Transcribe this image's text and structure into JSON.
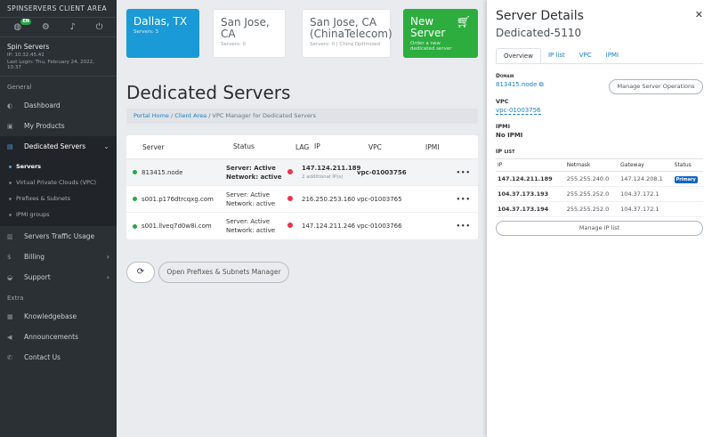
{
  "sidebar": {
    "brand": "SPINSERVERS CLIENT AREA",
    "lang": "EN",
    "user": {
      "name": "Spin Servers",
      "ip": "IP: 10.32.45.42",
      "login": "Last Login: Thu, February 24, 2022, 10:37"
    },
    "section_general": "General",
    "dashboard": "Dashboard",
    "products": "My Products",
    "dedicated": "Dedicated Servers",
    "sub": [
      "Servers",
      "Virtual Private Clouds (VPC)",
      "Prefixes & Subnets",
      "IPMI groups"
    ],
    "traffic": "Servers Traffic Usage",
    "billing": "Billing",
    "support": "Support",
    "section_extra": "Extra",
    "kb": "Knowledgebase",
    "ann": "Announcements",
    "contact": "Contact Us"
  },
  "cards": {
    "dallas": {
      "title": "Dallas, TX",
      "sub": "Servers: 3"
    },
    "sanjose": {
      "title": "San Jose, CA",
      "sub": "Servers: 0"
    },
    "sanjose_ct": {
      "title": "San Jose, CA (ChinaTelecom)",
      "sub": "Servers: 0 | China Optimized"
    },
    "new": {
      "title": "New Server",
      "sub": "Order a new dedicated server"
    }
  },
  "page": {
    "title": "Dedicated Servers",
    "crumbs": [
      "Portal Home",
      "Client Area",
      "VPC Manager for Dedicated Servers"
    ],
    "crumb_sep": "/",
    "table": {
      "headers": [
        "Server",
        "Status",
        "LAG",
        "IP",
        "VPC",
        "IPMI"
      ],
      "rows": [
        {
          "server": "813415.node",
          "status1": "Server: Active",
          "status2": "Network: active",
          "ip": "147.124.211.189",
          "extra": "2 additional IP(s)",
          "vpc": "vpc-01003756"
        },
        {
          "server": "s001.p176dtrcqxg.com",
          "status1": "Server: Active",
          "status2": "Network: active",
          "ip": "216.250.253.160",
          "extra": "",
          "vpc": "vpc-01003765"
        },
        {
          "server": "s001.llveq7d0w8i.com",
          "status1": "Server: Active",
          "status2": "Network: active",
          "ip": "147.124.211.246",
          "extra": "",
          "vpc": "vpc-01003766"
        }
      ],
      "dots": "•••"
    },
    "open_button": "Open Prefixes & Subnets Manager"
  },
  "panel": {
    "title": "Server Details",
    "subtitle": "Dedicated-5110",
    "close": "✕",
    "tabs": [
      "Overview",
      "IP list",
      "VPC",
      "IPMI"
    ],
    "domain_label": "Domain",
    "domain": "813415.node",
    "manage_ops": "Manage Server Operations",
    "vpc_label": "VPC",
    "vpc": "vpc-01003756",
    "ipmi_label": "IPMI",
    "ipmi": "No IPMI",
    "iplist_label": "IP list",
    "ip_headers": [
      "IP",
      "Netmask",
      "Gateway",
      "Status"
    ],
    "ips": [
      {
        "ip": "147.124.211.189",
        "mask": "255.255.240.0",
        "gw": "147.124.208.1",
        "status": "Primary"
      },
      {
        "ip": "104.37.173.193",
        "mask": "255.255.252.0",
        "gw": "104.37.172.1",
        "status": ""
      },
      {
        "ip": "104.37.173.194",
        "mask": "255.255.252.0",
        "gw": "104.37.172.1",
        "status": ""
      }
    ],
    "manage_ip": "Manage IP list"
  }
}
